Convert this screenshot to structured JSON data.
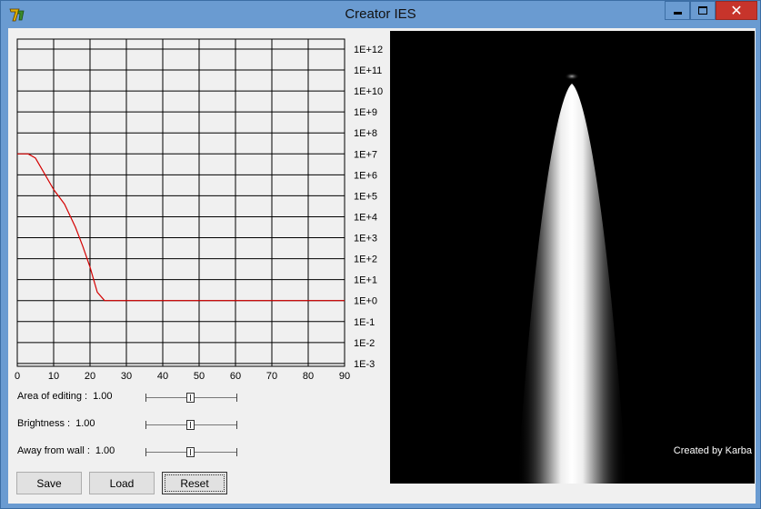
{
  "window": {
    "title": "Creator IES",
    "close_glyph": "✕"
  },
  "graph": {
    "y_ticks": [
      "1E+12",
      "1E+11",
      "1E+10",
      "1E+9",
      "1E+8",
      "1E+7",
      "1E+6",
      "1E+5",
      "1E+4",
      "1E+3",
      "1E+2",
      "1E+1",
      "1E+0",
      "1E-1",
      "1E-2",
      "1E-3"
    ],
    "x_ticks": [
      "0",
      "10",
      "20",
      "30",
      "40",
      "50",
      "60",
      "70",
      "80",
      "90"
    ],
    "curve_color": "#d40000",
    "chart_data": {
      "type": "line",
      "x": [
        0,
        3,
        5,
        7,
        10,
        13,
        16,
        18,
        20,
        22,
        24,
        30,
        90
      ],
      "y_log10": [
        7,
        7,
        6.8,
        6.2,
        5.3,
        4.6,
        3.5,
        2.6,
        1.6,
        0.4,
        0,
        0,
        0
      ],
      "xlim": [
        0,
        90
      ],
      "ylim_log10": [
        -3,
        12
      ],
      "yscale": "log",
      "grid": true
    }
  },
  "controls": {
    "area": {
      "label": "Area of editing :",
      "value": "1.00"
    },
    "brightness": {
      "label": "Brightness :",
      "value": "1.00"
    },
    "away": {
      "label": "Away from wall :",
      "value": "1.00"
    }
  },
  "buttons": {
    "save": "Save",
    "load": "Load",
    "reset": "Reset"
  },
  "preview": {
    "credit": "Created by Karba"
  }
}
